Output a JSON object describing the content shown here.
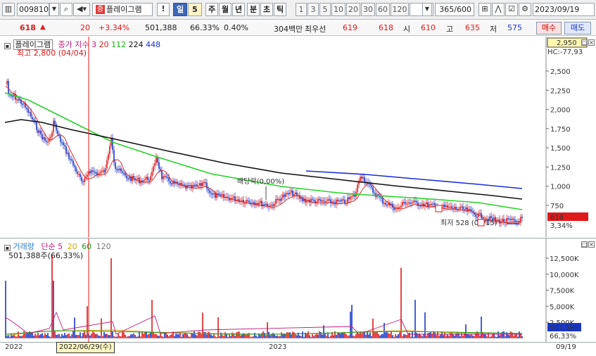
{
  "toolbar": {
    "code": "009810",
    "stock_badge": "증",
    "stock_name": "플레이그램",
    "period_buttons": [
      "일",
      "5",
      "주",
      "월",
      "년",
      "분",
      "초",
      "틱"
    ],
    "interval_buttons": [
      "1",
      "3",
      "5",
      "10",
      "20",
      "30",
      "60",
      "120"
    ],
    "count": "365",
    "count_total": "/600",
    "date": "2023/09/19"
  },
  "quote": {
    "price": "618",
    "change_arrow": "▲",
    "change": "20",
    "change_pct": "+3.34%",
    "volume": "501,388",
    "volume_ratio": "66.33%",
    "turnover": "0.40%",
    "amount": "304백만",
    "bid_label": "최우선",
    "bid1": "619",
    "bid2": "618",
    "open_label": "시",
    "open": "610",
    "high_label": "고",
    "high": "635",
    "low_label": "저",
    "low": "575",
    "buy_label": "매수",
    "sell_label": "매도"
  },
  "price_pane": {
    "name": "플레이그램",
    "ma_label": "종가 지수",
    "ma_periods": [
      "3",
      "20",
      "112",
      "224",
      "448"
    ],
    "max_annotation": "최고 2,800 (04/04)",
    "min_annotation": "최저 528 (09/15)",
    "dividend_annotation": "배당락(0,00%)",
    "top_price_box": "2,950",
    "hc_label": "HC:-77,93",
    "current_price_box": "618",
    "current_pct": "3,34%",
    "y_ticks": [
      "2,500",
      "2,250",
      "2,000",
      "1,750",
      "1,500",
      "1,250",
      "1,000",
      "750"
    ]
  },
  "volume_pane": {
    "title": "거래량",
    "ma_label": "단순",
    "ma_periods": [
      "5",
      "20",
      "60",
      "120"
    ],
    "vol_annotation": "501,388주(66,33%)",
    "y_ticks": [
      "12,500K",
      "10,000K",
      "7,500K",
      "5,000K",
      "2,500K"
    ],
    "current_vol_box": "501,388",
    "current_vol_pct": "66,33%"
  },
  "x_axis": {
    "labels": [
      "2022",
      "2023",
      "09/19"
    ],
    "cursor_date": "2022/06/29(수)"
  },
  "colors": {
    "up": "#e0191b",
    "down": "#1a37c8",
    "ma20": "#d81c1c",
    "ma112": "#25d425",
    "ma224": "#111111",
    "ma448": "#1a2fd9",
    "cursor": "#e0191b"
  },
  "icons": [
    "dropdown-icon",
    "search-icon",
    "speaker-icon",
    "exclamation-icon",
    "chart-settings-icon",
    "checkbox-icon",
    "gear-icon",
    "sort-icon"
  ]
}
